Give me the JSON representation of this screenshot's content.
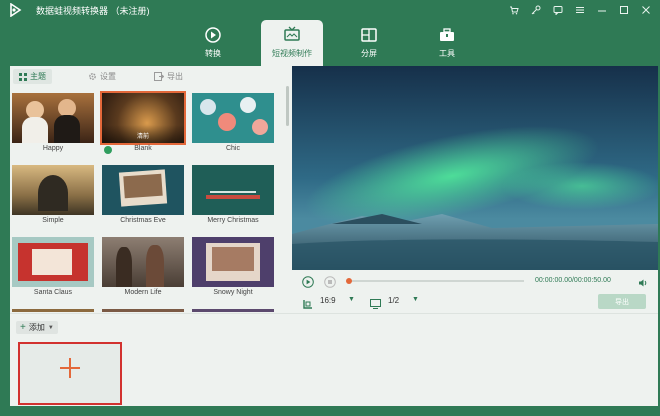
{
  "app": {
    "title": "数据蛙视频转换器 （未注册)"
  },
  "main_tabs": [
    {
      "label": "转换",
      "icon": "convert-icon"
    },
    {
      "label": "短视频制作",
      "icon": "tv-icon"
    },
    {
      "label": "分屏",
      "icon": "split-screen-icon"
    },
    {
      "label": "工具",
      "icon": "toolbox-icon"
    }
  ],
  "sub_tabs": [
    {
      "label": "主题",
      "icon": "grid-icon"
    },
    {
      "label": "设置",
      "icon": "gear-icon"
    },
    {
      "label": "导出",
      "icon": "export-icon"
    }
  ],
  "themes": [
    {
      "name": "Happy"
    },
    {
      "name": "Blank",
      "overlay": "清前",
      "selected": true
    },
    {
      "name": "Chic"
    },
    {
      "name": "Simple"
    },
    {
      "name": "Christmas Eve"
    },
    {
      "name": "Merry Christmas"
    },
    {
      "name": "Santa Claus"
    },
    {
      "name": "Modern Life"
    },
    {
      "name": "Snowy Night"
    }
  ],
  "player": {
    "time": "00:00:00.00/00:00:50.00",
    "ratio": "16:9",
    "screen": "1/2",
    "export_label": "导出",
    "progress": 0
  },
  "bottom": {
    "add_label": "添加"
  },
  "colors": {
    "brand": "#2f7a55",
    "accent": "#e3683a",
    "drop_border": "#d2322f"
  }
}
